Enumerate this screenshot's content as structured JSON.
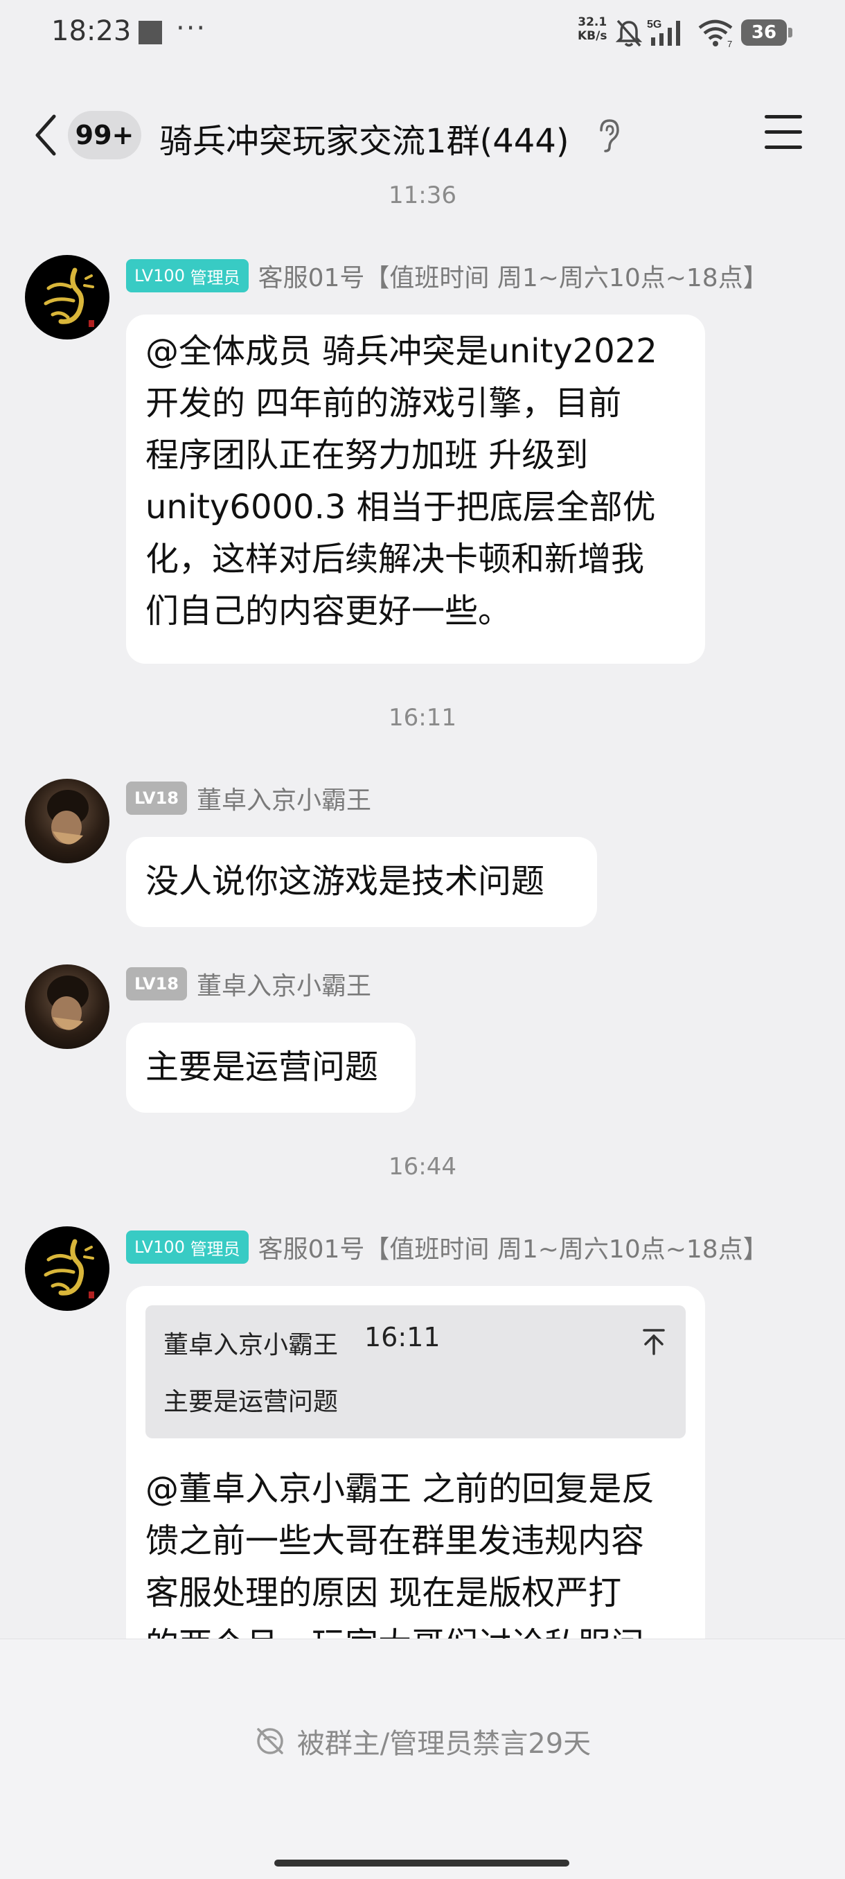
{
  "status_bar": {
    "time": "18:23",
    "overflow": "···",
    "speed_value": "32.1",
    "speed_unit": "KB/s",
    "network": "5G",
    "wifi_sub": "7",
    "battery": "36"
  },
  "header": {
    "unread_count": "99+",
    "title": "骑兵冲突玩家交流1群(444)"
  },
  "messages": [
    {
      "time": "11:36",
      "level": "LV100",
      "role": "管理员",
      "sender": "客服01号【值班时间 周1~周六10点~18点】",
      "lines": [
        "@全体成员 骑兵冲突是unity2022",
        "开发的  四年前的游戏引擎，目前",
        "程序团队正在努力加班 升级到",
        "unity6000.3  相当于把底层全部优",
        "化，这样对后续解决卡顿和新增我",
        "们自己的内容更好一些。"
      ]
    },
    {
      "time": "16:11",
      "level": "LV18",
      "sender": "董卓入京小霸王",
      "lines": [
        "没人说你这游戏是技术问题"
      ]
    },
    {
      "level": "LV18",
      "sender": "董卓入京小霸王",
      "lines": [
        "主要是运营问题"
      ]
    },
    {
      "time": "16:44",
      "level": "LV100",
      "role": "管理员",
      "sender": "客服01号【值班时间 周1~周六10点~18点】",
      "quote": {
        "name": "董卓入京小霸王",
        "time": "16:11",
        "text": "主要是运营问题"
      },
      "lines": [
        "@董卓入京小霸王 之前的回复是反",
        "馈之前一些大哥在群里发违规内容",
        "客服处理的原因  现在是版权严打",
        "的两个月，玩家大哥们讨论私服问"
      ]
    }
  ],
  "footer": {
    "mute_text": "被群主/管理员禁言29天"
  },
  "colors": {
    "background": "#f0f0f2",
    "admin_badge": "#38cbc4",
    "level_badge": "#b3b3b3"
  },
  "icons": [
    "back-icon",
    "ear-icon",
    "menu-icon",
    "mute-icon",
    "jump-to-quote-icon",
    "wifi-icon",
    "signal-icon",
    "bell-off-icon",
    "battery-icon"
  ]
}
